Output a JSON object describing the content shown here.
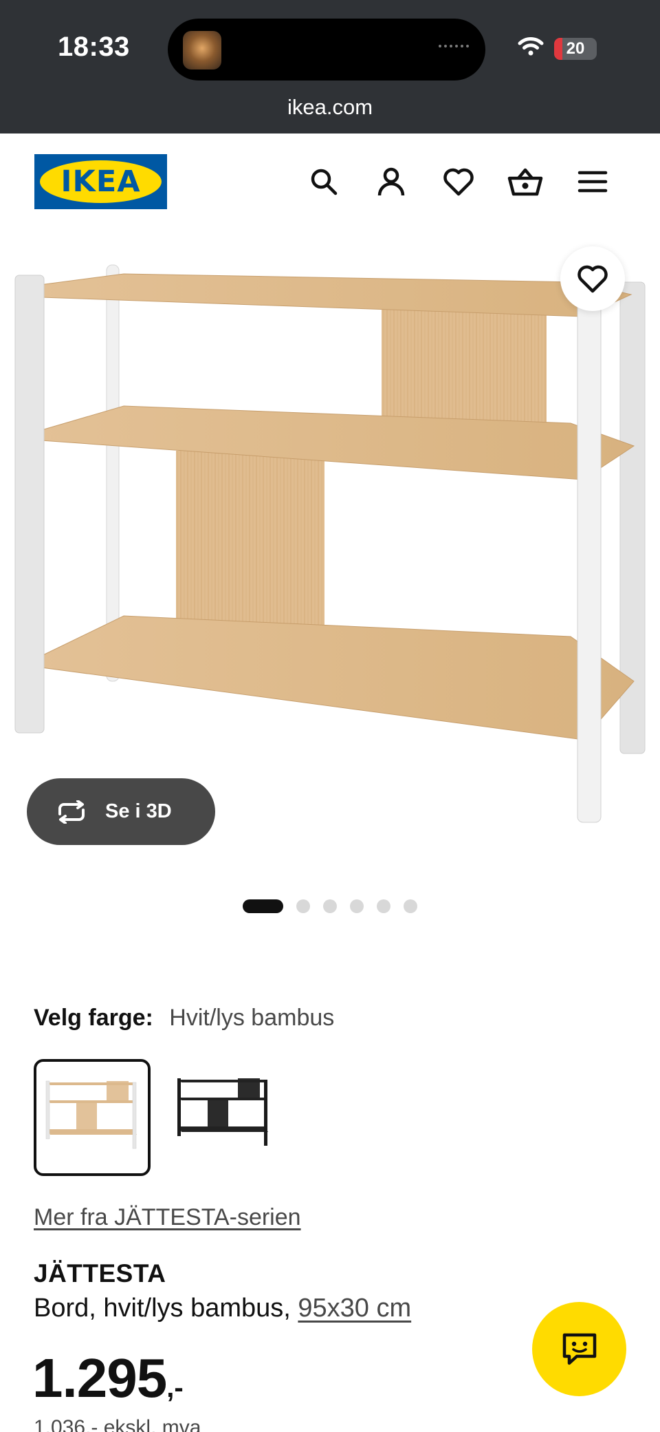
{
  "status_bar": {
    "time": "18:33",
    "battery_level": "20",
    "battery_fraction": 0.2
  },
  "browser": {
    "url": "ikea.com"
  },
  "header": {
    "logo_text": "IKEA",
    "icons": [
      "search-icon",
      "account-icon",
      "heart-icon",
      "basket-icon",
      "menu-icon"
    ]
  },
  "gallery": {
    "view_3d_label": "Se i 3D",
    "image_count": 6,
    "active_index": 0
  },
  "color_select": {
    "label": "Velg farge:",
    "value": "Hvit/lys bambus",
    "options": [
      "Hvit/lys bambus",
      "Svart"
    ],
    "selected_index": 0
  },
  "product": {
    "series_link": "Mer fra JÄTTESTA-serien",
    "name": "JÄTTESTA",
    "description": "Bord, hvit/lys bambus, ",
    "dimensions": "95x30 cm",
    "price_main": "1.295",
    "price_suffix": ",-",
    "price_sub": "1.036,- ekskl. mva"
  },
  "colors": {
    "ikea_blue": "#0058a3",
    "ikea_yellow": "#ffdb00",
    "topbar": "#2f3236",
    "view3d_button": "#484848"
  }
}
